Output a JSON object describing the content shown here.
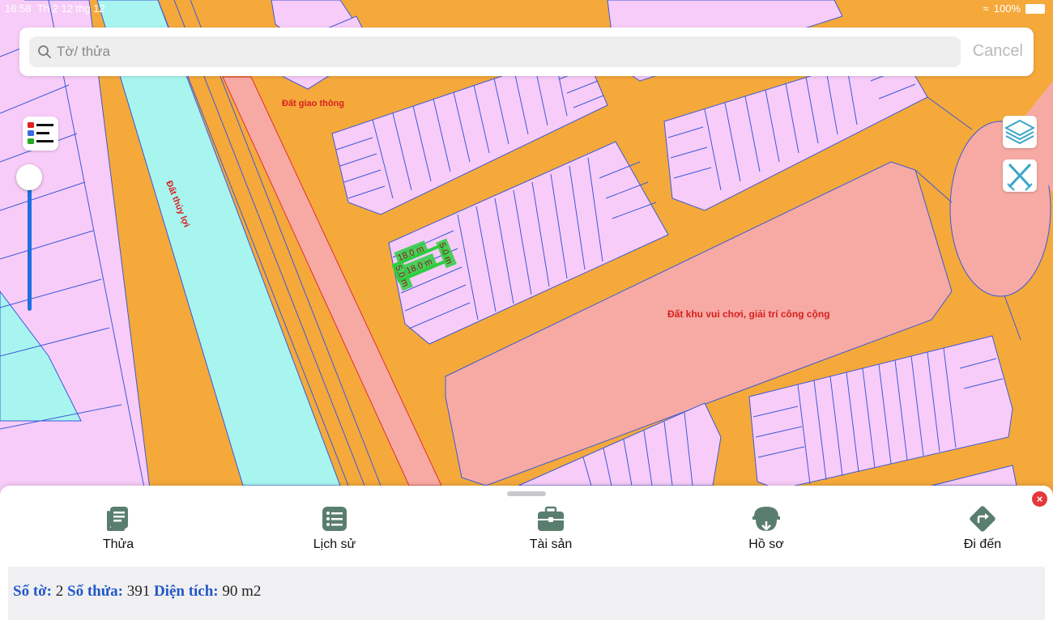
{
  "status_bar": {
    "time": "16:58",
    "date": "Th 2 12 thg 12",
    "battery": "100%"
  },
  "search": {
    "placeholder": "Tờ/ thửa",
    "value": "",
    "cancel_label": "Cancel"
  },
  "map": {
    "labels": {
      "road_land": "Đất giao thông",
      "irrigation_land": "Đất thủy lợi",
      "park_land": "Đất khu vui chơi, giải trí công cộng"
    },
    "selected_parcel_dimensions": {
      "top": "18.0 m",
      "bottom": "18.0 m",
      "right": "5.0 m",
      "left": "5.0 m"
    },
    "colors": {
      "road": "#f5a93b",
      "residential": "#f8ccf8",
      "irrigation": "#a8f5f0",
      "park": "#f7aaa3",
      "selection": "#2ecc40",
      "parcel_line": "#3a5ad8"
    }
  },
  "controls": {
    "legend_icon": "legend-list-icon",
    "layers_icon": "layers-icon",
    "tools_icon": "measure-tools-icon",
    "zoom_slider_level": 0.9
  },
  "bottom_sheet": {
    "tabs": [
      {
        "label": "Thửa",
        "icon": "parcel-document-icon"
      },
      {
        "label": "Lịch sử",
        "icon": "history-list-icon"
      },
      {
        "label": "Tài sản",
        "icon": "briefcase-icon"
      },
      {
        "label": "Hồ sơ",
        "icon": "file-tray-icon"
      },
      {
        "label": "Đi đến",
        "icon": "directions-icon"
      }
    ],
    "info": {
      "sheet_label": "Số tờ:",
      "sheet_value": "2",
      "parcel_label": "Số thửa:",
      "parcel_value": "391",
      "area_label": "Diện tích:",
      "area_value": "90 m2"
    },
    "close_icon": "close-icon"
  }
}
